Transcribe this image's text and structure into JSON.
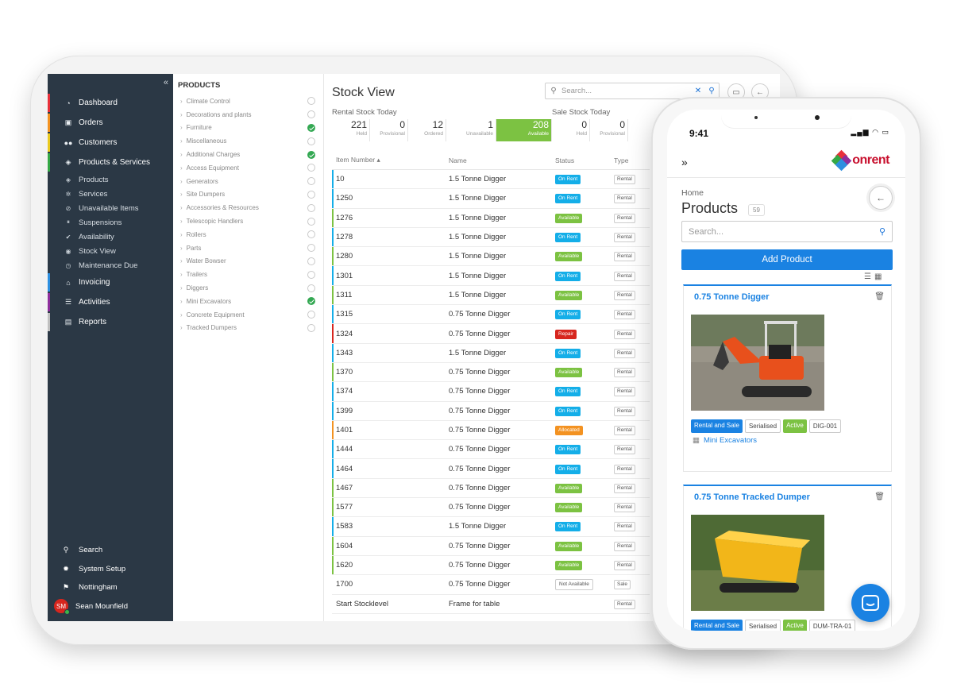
{
  "tablet": {
    "sidebar": {
      "collapse_icon": "double-chevron-left-icon",
      "main_items": [
        {
          "label": "Dashboard",
          "icon": "tachometer-icon",
          "color": "#e8303a"
        },
        {
          "label": "Orders",
          "icon": "cart-icon",
          "color": "#f39221"
        },
        {
          "label": "Customers",
          "icon": "users-icon",
          "color": "#e9c91f"
        },
        {
          "label": "Products & Services",
          "icon": "cubes-icon",
          "color": "#35a845"
        }
      ],
      "sub_items": [
        {
          "label": "Products",
          "icon": "cubes-icon"
        },
        {
          "label": "Services",
          "icon": "cogs-icon"
        },
        {
          "label": "Unavailable Items",
          "icon": "ban-icon"
        },
        {
          "label": "Suspensions",
          "icon": "pause-icon"
        },
        {
          "label": "Availability",
          "icon": "check-circle-icon"
        },
        {
          "label": "Stock View",
          "icon": "eye-icon"
        },
        {
          "label": "Maintenance Due",
          "icon": "clock-icon"
        }
      ],
      "lower_items": [
        {
          "label": "Invoicing",
          "icon": "bank-icon",
          "color": "#2d8fe0"
        },
        {
          "label": "Activities",
          "icon": "tasks-icon",
          "color": "#8e2f9c"
        },
        {
          "label": "Reports",
          "icon": "chart-icon",
          "color": "#bfbfbf"
        }
      ],
      "bottom": {
        "search": "Search",
        "system_setup": "System Setup",
        "location": "Nottingham",
        "user_initials": "SM",
        "user_name": "Sean Mounfield"
      }
    },
    "products_panel": {
      "heading": "PRODUCTS",
      "categories": [
        {
          "name": "Climate Control",
          "checked": false
        },
        {
          "name": "Decorations and plants",
          "checked": false
        },
        {
          "name": "Furniture",
          "checked": true
        },
        {
          "name": "Miscellaneous",
          "checked": false
        },
        {
          "name": "Additional Charges",
          "checked": true
        },
        {
          "name": "Access Equipment",
          "checked": false
        },
        {
          "name": "Generators",
          "checked": false
        },
        {
          "name": "Site Dumpers",
          "checked": false
        },
        {
          "name": "Accessories & Resources",
          "checked": false
        },
        {
          "name": "Telescopic Handlers",
          "checked": false
        },
        {
          "name": "Rollers",
          "checked": false
        },
        {
          "name": "Parts",
          "checked": false
        },
        {
          "name": "Water Bowser",
          "checked": false
        },
        {
          "name": "Trailers",
          "checked": false
        },
        {
          "name": "Diggers",
          "checked": false
        },
        {
          "name": "Mini Excavators",
          "checked": true
        },
        {
          "name": "Concrete Equipment",
          "checked": false
        },
        {
          "name": "Tracked Dumpers",
          "checked": false
        }
      ]
    },
    "stock_view": {
      "title": "Stock View",
      "search_placeholder": "Search...",
      "rental_title": "Rental Stock Today",
      "sale_title": "Sale Stock Today",
      "rental_stats": [
        {
          "value": "221",
          "label": "Held"
        },
        {
          "value": "0",
          "label": "Provisional"
        },
        {
          "value": "12",
          "label": "Ordered"
        },
        {
          "value": "1",
          "label": "Unavailable"
        },
        {
          "value": "208",
          "label": "Available"
        }
      ],
      "sale_stats": [
        {
          "value": "0",
          "label": "Held"
        },
        {
          "value": "0",
          "label": "Provisional"
        }
      ],
      "columns": [
        "Item Number",
        "Name",
        "Status",
        "Type"
      ],
      "rows": [
        {
          "item": "10",
          "name": "1.5 Tonne Digger",
          "status": "On Rent",
          "type": "Rental"
        },
        {
          "item": "1250",
          "name": "1.5 Tonne Digger",
          "status": "On Rent",
          "type": "Rental"
        },
        {
          "item": "1276",
          "name": "1.5 Tonne Digger",
          "status": "Available",
          "type": "Rental"
        },
        {
          "item": "1278",
          "name": "1.5 Tonne Digger",
          "status": "On Rent",
          "type": "Rental"
        },
        {
          "item": "1280",
          "name": "1.5 Tonne Digger",
          "status": "Available",
          "type": "Rental"
        },
        {
          "item": "1301",
          "name": "1.5 Tonne Digger",
          "status": "On Rent",
          "type": "Rental"
        },
        {
          "item": "1311",
          "name": "1.5 Tonne Digger",
          "status": "Available",
          "type": "Rental"
        },
        {
          "item": "1315",
          "name": "0.75 Tonne Digger",
          "status": "On Rent",
          "type": "Rental"
        },
        {
          "item": "1324",
          "name": "0.75 Tonne Digger",
          "status": "Repair",
          "type": "Rental"
        },
        {
          "item": "1343",
          "name": "1.5 Tonne Digger",
          "status": "On Rent",
          "type": "Rental"
        },
        {
          "item": "1370",
          "name": "0.75 Tonne Digger",
          "status": "Available",
          "type": "Rental"
        },
        {
          "item": "1374",
          "name": "0.75 Tonne Digger",
          "status": "On Rent",
          "type": "Rental"
        },
        {
          "item": "1399",
          "name": "0.75 Tonne Digger",
          "status": "On Rent",
          "type": "Rental"
        },
        {
          "item": "1401",
          "name": "0.75 Tonne Digger",
          "status": "Allocated",
          "type": "Rental"
        },
        {
          "item": "1444",
          "name": "0.75 Tonne Digger",
          "status": "On Rent",
          "type": "Rental"
        },
        {
          "item": "1464",
          "name": "0.75 Tonne Digger",
          "status": "On Rent",
          "type": "Rental"
        },
        {
          "item": "1467",
          "name": "0.75 Tonne Digger",
          "status": "Available",
          "type": "Rental"
        },
        {
          "item": "1577",
          "name": "0.75 Tonne Digger",
          "status": "Available",
          "type": "Rental"
        },
        {
          "item": "1583",
          "name": "1.5 Tonne Digger",
          "status": "On Rent",
          "type": "Rental"
        },
        {
          "item": "1604",
          "name": "0.75 Tonne Digger",
          "status": "Available",
          "type": "Rental"
        },
        {
          "item": "1620",
          "name": "0.75 Tonne Digger",
          "status": "Available",
          "type": "Rental"
        },
        {
          "item": "1700",
          "name": "0.75 Tonne Digger",
          "status": "Not Available",
          "type": "Sale"
        },
        {
          "item": "Start Stocklevel",
          "name": "Frame for table",
          "status": "",
          "type": "Rental"
        }
      ],
      "status_colors": {
        "On Rent": "#14aee8",
        "Available": "#7cc242",
        "Repair": "#d7261e",
        "Allocated": "#f39221",
        "Not Available": "#ffffff"
      }
    }
  },
  "phone": {
    "time": "9:41",
    "menu_icon": "double-chevron-right-icon",
    "brand": "onrent",
    "breadcrumb": "Home",
    "title": "Products",
    "count": "59",
    "search_placeholder": "Search...",
    "add_button": "Add Product",
    "cards": [
      {
        "title": "0.75 Tonne Digger",
        "tags": [
          "Rental and Sale",
          "Serialised",
          "Active",
          "DIG-001"
        ],
        "category": "Mini Excavators"
      },
      {
        "title": "0.75 Tonne Tracked Dumper",
        "tags": [
          "Rental and Sale",
          "Serialised",
          "Active",
          "DUM-TRA-01"
        ],
        "category": ""
      }
    ]
  }
}
